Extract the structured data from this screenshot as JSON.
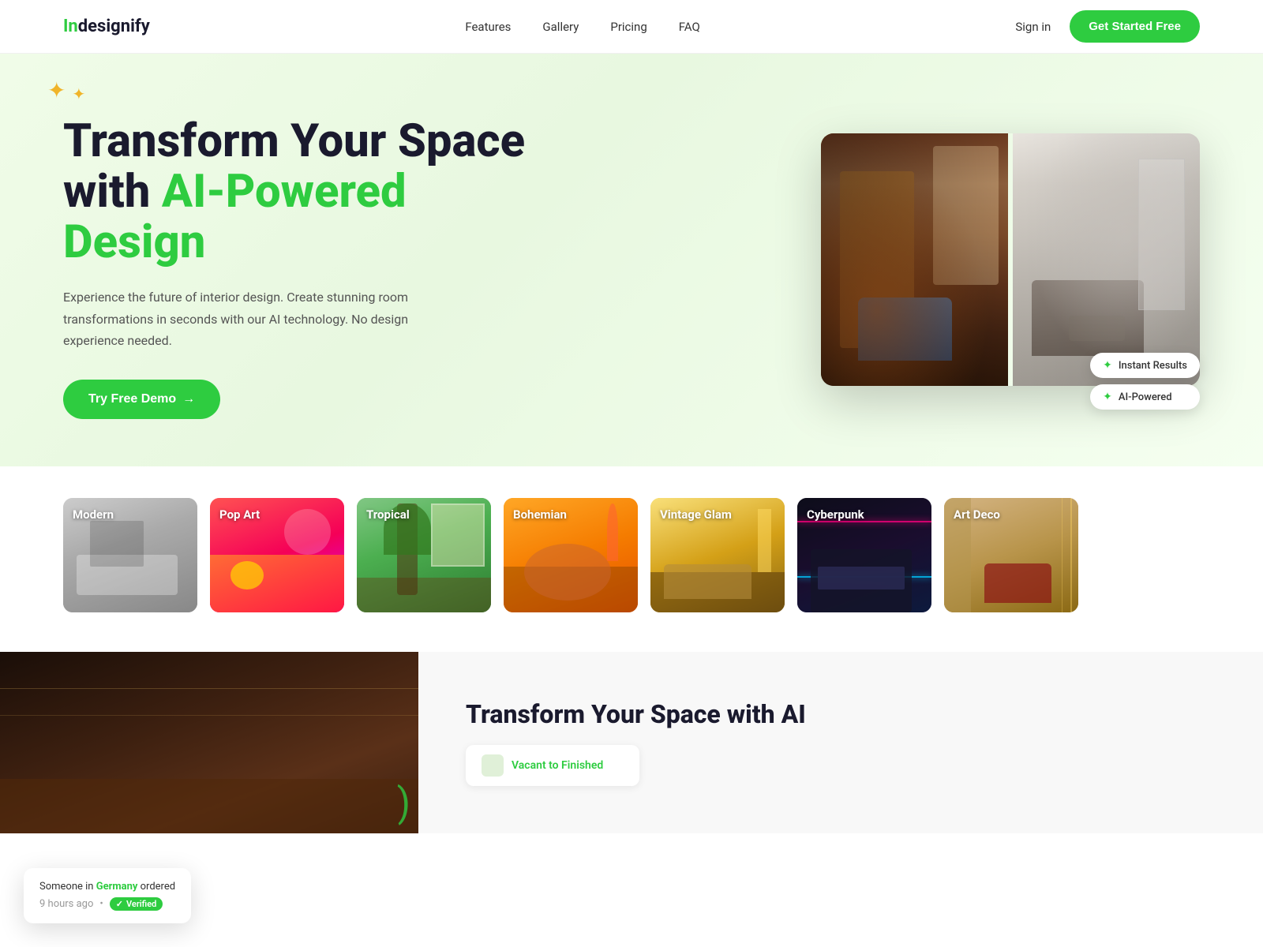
{
  "brand": {
    "name_part1": "In",
    "name_part2": "designify"
  },
  "navbar": {
    "logo": "Indesignify",
    "links": [
      {
        "label": "Features",
        "href": "#"
      },
      {
        "label": "Gallery",
        "href": "#"
      },
      {
        "label": "Pricing",
        "href": "#"
      },
      {
        "label": "FAQ",
        "href": "#"
      }
    ],
    "signin": "Sign in",
    "cta": "Get Started Free"
  },
  "hero": {
    "title_line1": "Transform Your Space",
    "title_line2": "with ",
    "title_highlight": "AI-Powered",
    "title_line3": "Design",
    "subtitle": "Experience the future of interior design. Create stunning room transformations in seconds with our AI technology. No design experience needed.",
    "cta": "Try Free Demo",
    "badge1": "Instant Results",
    "badge2": "AI-Powered"
  },
  "gallery": {
    "items": [
      {
        "label": "Modern",
        "class": "gi-modern"
      },
      {
        "label": "Pop Art",
        "class": "gi-popart"
      },
      {
        "label": "Tropical",
        "class": "gi-tropical"
      },
      {
        "label": "Bohemian",
        "class": "gi-bohemian"
      },
      {
        "label": "Vintage Glam",
        "class": "gi-vintage"
      },
      {
        "label": "Cyberpunk",
        "class": "gi-cyberpunk"
      },
      {
        "label": "Art Deco",
        "class": "gi-artdeco"
      }
    ]
  },
  "bottom": {
    "title": "Transform Your Space with AI",
    "vacant_label": "Vacant to Finished"
  },
  "notification": {
    "title": "Someone in ",
    "country": "Germany",
    "title_end": " ordered",
    "time": "9 hours ago",
    "verified": "Verified"
  }
}
